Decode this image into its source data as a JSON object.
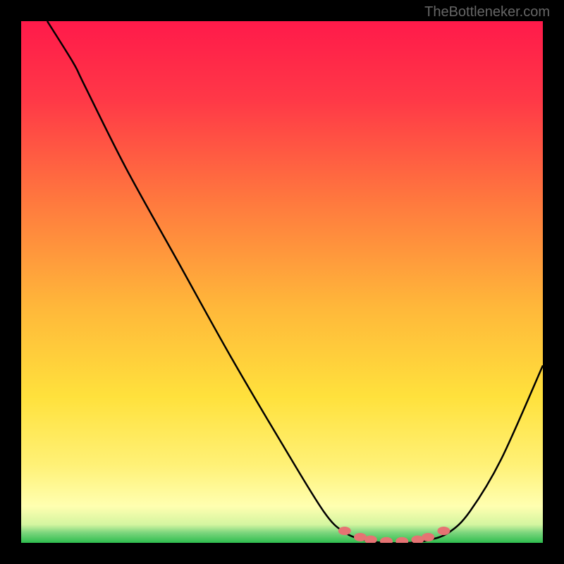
{
  "watermark": "TheBottleneker.com",
  "chart_data": {
    "type": "line",
    "title": "",
    "xlabel": "",
    "ylabel": "",
    "xlim": [
      0,
      100
    ],
    "ylim": [
      0,
      100
    ],
    "gradient_colors": {
      "top": "#ff1744",
      "upper_mid": "#ff6d3a",
      "mid": "#ffc107",
      "lower_mid": "#ffeb3b",
      "near_bottom": "#fff59d",
      "bottom": "#4caf50"
    },
    "curve_points": [
      {
        "x": 5,
        "y": 100
      },
      {
        "x": 10,
        "y": 92
      },
      {
        "x": 12,
        "y": 88
      },
      {
        "x": 20,
        "y": 72
      },
      {
        "x": 30,
        "y": 54
      },
      {
        "x": 40,
        "y": 36
      },
      {
        "x": 50,
        "y": 19
      },
      {
        "x": 58,
        "y": 6
      },
      {
        "x": 62,
        "y": 2
      },
      {
        "x": 66,
        "y": 0.5
      },
      {
        "x": 70,
        "y": 0
      },
      {
        "x": 74,
        "y": 0
      },
      {
        "x": 78,
        "y": 0.5
      },
      {
        "x": 82,
        "y": 2
      },
      {
        "x": 86,
        "y": 6
      },
      {
        "x": 92,
        "y": 16
      },
      {
        "x": 100,
        "y": 34
      }
    ],
    "markers": [
      {
        "x": 62,
        "y": 2.3
      },
      {
        "x": 65,
        "y": 1.1
      },
      {
        "x": 67,
        "y": 0.6
      },
      {
        "x": 70,
        "y": 0.3
      },
      {
        "x": 73,
        "y": 0.3
      },
      {
        "x": 76,
        "y": 0.6
      },
      {
        "x": 78,
        "y": 1.1
      },
      {
        "x": 81,
        "y": 2.3
      }
    ],
    "marker_color": "#e57373"
  }
}
